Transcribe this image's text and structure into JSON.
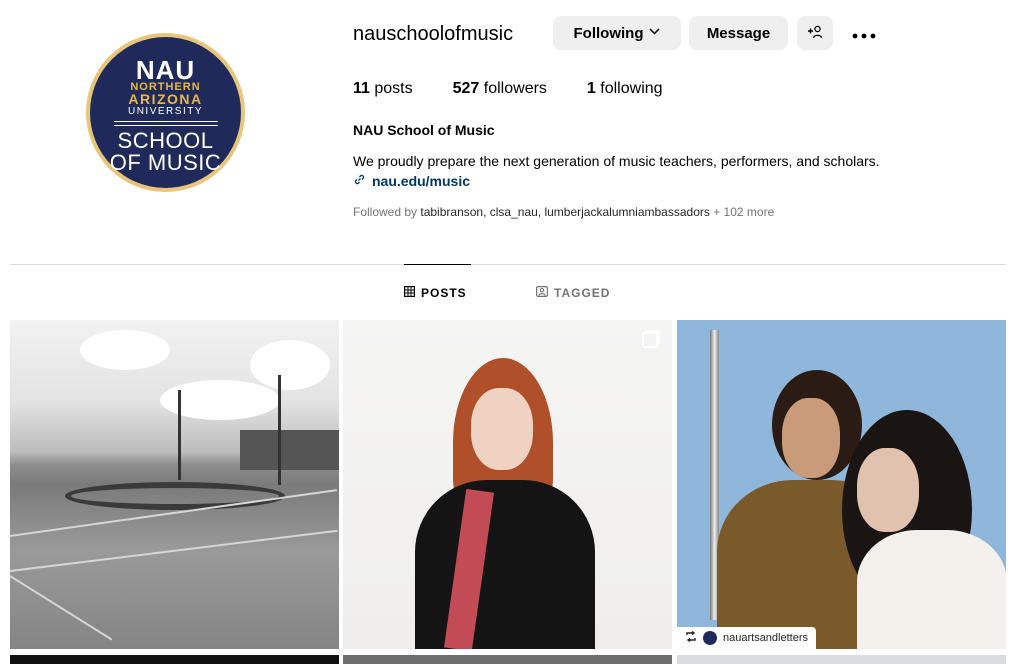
{
  "profile": {
    "avatar": {
      "nau": "NAU",
      "northern": "NORTHERN",
      "arizona": "ARIZONA",
      "university": "UNIVERSITY",
      "school_line1": "SCHOOL",
      "school_line2": "OF MUSIC",
      "colors": {
        "navy": "#1f2a5b",
        "gold": "#e8b74a"
      }
    },
    "username": "nauschoolofmusic",
    "buttons": {
      "following": "Following",
      "following_icon": "chevron-down-icon",
      "message": "Message",
      "add_user_icon": "+ person-icon",
      "add_user_glyph": "+👤",
      "more_icon": "more-options-icon",
      "more_glyph": "•••"
    },
    "stats": {
      "posts_count": "11",
      "posts_label": "posts",
      "followers_count": "527",
      "followers_label": "followers",
      "following_count": "1",
      "following_label": "following"
    },
    "full_name": "NAU School of Music",
    "bio": "We proudly prepare the next generation of music teachers, performers, and scholars.",
    "link": {
      "icon": "link-icon",
      "glyph": "🔗",
      "text": "nau.edu/music"
    },
    "followed_by": {
      "prefix": "Followed by",
      "users": "tabibranson, clsa_nau, lumberjackalumniambassadors",
      "suffix": "+ 102 more"
    }
  },
  "tabs": [
    {
      "label": "POSTS",
      "icon": "grid-icon",
      "glyph": "▦",
      "active": true
    },
    {
      "label": "TAGGED",
      "icon": "tagged-icon",
      "glyph": "◫",
      "active": false
    }
  ],
  "posts": [
    {
      "alt": "stadium",
      "multi": false
    },
    {
      "alt": "performer",
      "multi": true
    },
    {
      "alt": "flute duo",
      "multi": false,
      "repost": {
        "icon": "repost-icon",
        "glyph": "⟲",
        "account": "nauartsandletters"
      }
    }
  ]
}
